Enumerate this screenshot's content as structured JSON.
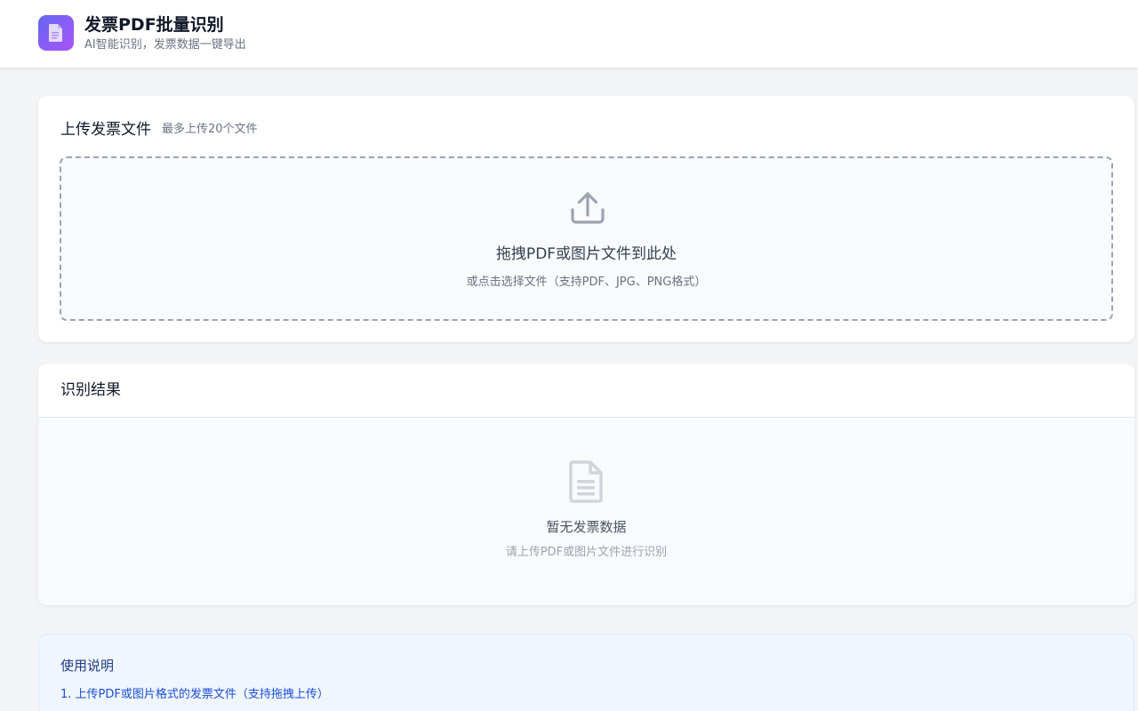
{
  "app": {
    "title": "发票PDF批量识别",
    "subtitle": "AI智能识别，发票数据一键导出",
    "logo_icon": "document-icon",
    "accent_gradient": [
      "#6366f1",
      "#a855f7"
    ]
  },
  "upload": {
    "title": "上传发票文件",
    "hint": "最多上传20个文件",
    "icon": "upload-icon",
    "drop_text": "拖拽PDF或图片文件到此处",
    "drop_subtext": "或点击选择文件（支持PDF、JPG、PNG格式）"
  },
  "results": {
    "title": "识别结果",
    "empty_icon": "document-icon",
    "empty_title": "暂无发票数据",
    "empty_subtitle": "请上传PDF或图片文件进行识别"
  },
  "help": {
    "title": "使用说明",
    "items": [
      "1. 上传PDF或图片格式的发票文件（支持拖拽上传）"
    ]
  }
}
